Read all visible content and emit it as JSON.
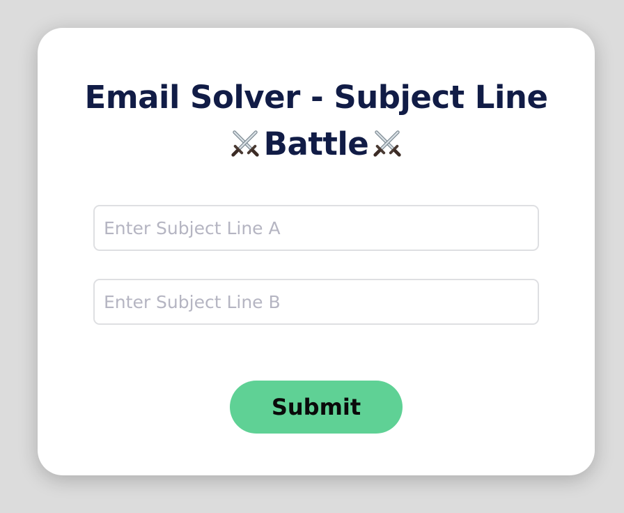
{
  "card": {
    "title_line1": "Email Solver - Subject Line",
    "title_line2_left_icon": "crossed-swords-icon",
    "title_line2": "Battle",
    "title_line2_right_icon": "crossed-swords-icon"
  },
  "form": {
    "subject_a": {
      "value": "",
      "placeholder": "Enter Subject Line A"
    },
    "subject_b": {
      "value": "",
      "placeholder": "Enter Subject Line B"
    },
    "submit_label": "Submit"
  },
  "colors": {
    "background": "#dcdcdc",
    "card": "#ffffff",
    "title": "#111c46",
    "button": "#5fd195",
    "button_text": "#0a0a0a",
    "input_border": "#dedfe2",
    "placeholder": "#b5b5c2"
  }
}
